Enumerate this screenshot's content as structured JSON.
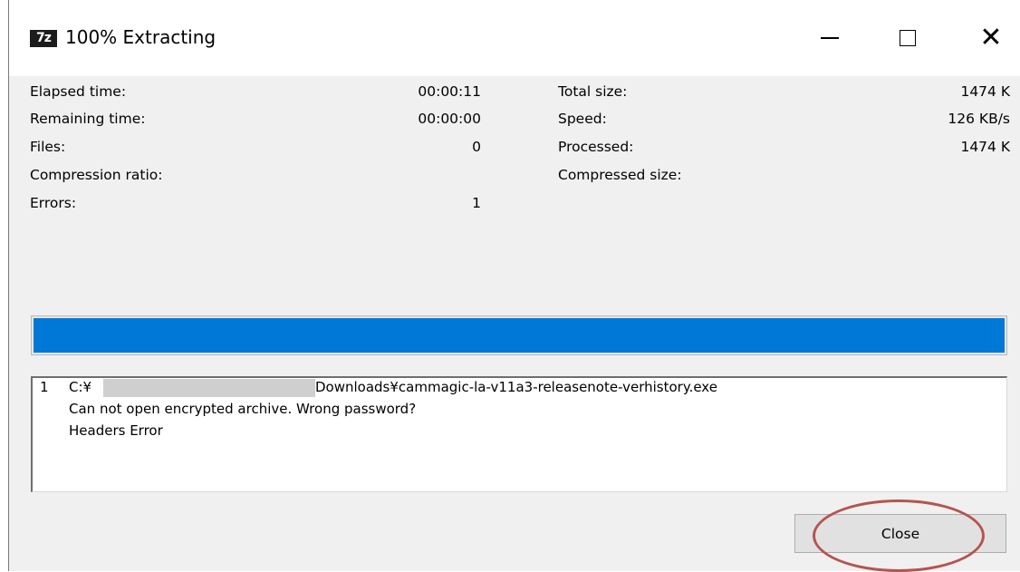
{
  "window": {
    "title": "100% Extracting",
    "app_icon_text": "7z",
    "controls": {
      "minimize": "minimize-icon",
      "maximize": "maximize-icon",
      "close": "close-icon"
    }
  },
  "stats_left": [
    {
      "label": "Elapsed time:",
      "value": "00:00:11"
    },
    {
      "label": "Remaining time:",
      "value": "00:00:00"
    },
    {
      "label": "Files:",
      "value": "0"
    },
    {
      "label": "Compression ratio:",
      "value": ""
    },
    {
      "label": "Errors:",
      "value": "1"
    }
  ],
  "stats_right": [
    {
      "label": "Total size:",
      "value": "1474 K"
    },
    {
      "label": "Speed:",
      "value": "126 KB/s"
    },
    {
      "label": "Processed:",
      "value": "1474 K"
    },
    {
      "label": "Compressed size:",
      "value": ""
    }
  ],
  "progress": {
    "percent": 100,
    "color": "#0078d7"
  },
  "log": {
    "index": "1",
    "path_prefix": "C:¥",
    "path_suffix": "Downloads¥cammagic-la-v11a3-releasenote-verhistory.exe",
    "messages": [
      "Can not open encrypted archive. Wrong password?",
      "Headers Error"
    ]
  },
  "buttons": {
    "close": "Close"
  },
  "colors": {
    "highlight": "#b5544f",
    "accent": "#0078d7"
  }
}
